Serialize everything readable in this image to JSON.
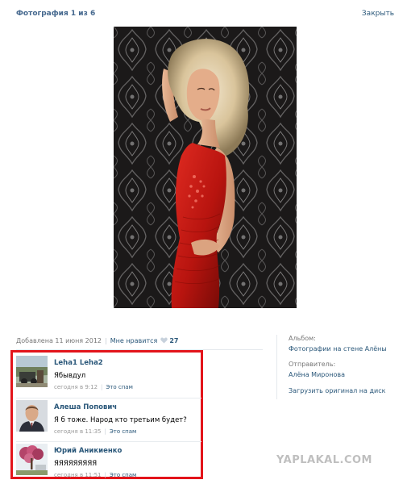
{
  "header": {
    "title": "Фотография 1 из 6",
    "close_label": "Закрыть"
  },
  "photo": {
    "icon": "photo-woman-red-dress"
  },
  "meta": {
    "added": "Добавлена 11 июня 2012",
    "separator": "|",
    "like_label": "Мне нравится",
    "like_icon": "heart-icon",
    "like_count": "27"
  },
  "side": {
    "album_label": "Альбом:",
    "album_value": "Фотографии на стене Алёны",
    "sender_label": "Отправитель:",
    "sender_value": "Алёна Миронова",
    "download_label": "Загрузить оригинал на диск"
  },
  "comments": [
    {
      "author": "Leha1 Leha2",
      "text": "Ябывдул",
      "time": "сегодня в 9:12",
      "spam": "Это спам"
    },
    {
      "author": "Алеша Попович",
      "text": "Я б тоже. Народ кто третьим будет?",
      "time": "сегодня в 11:35",
      "spam": "Это спам"
    },
    {
      "author": "Юрий Аникиенко",
      "text": "ЯЯЯЯЯЯЯЯЯ",
      "time": "сегодня в 11:51",
      "spam": "Это спам"
    }
  ],
  "watermark": "YAPLAKAL.COM",
  "colors": {
    "link": "#2b587a",
    "title": "#45688e",
    "highlight_border": "#e3141b"
  }
}
